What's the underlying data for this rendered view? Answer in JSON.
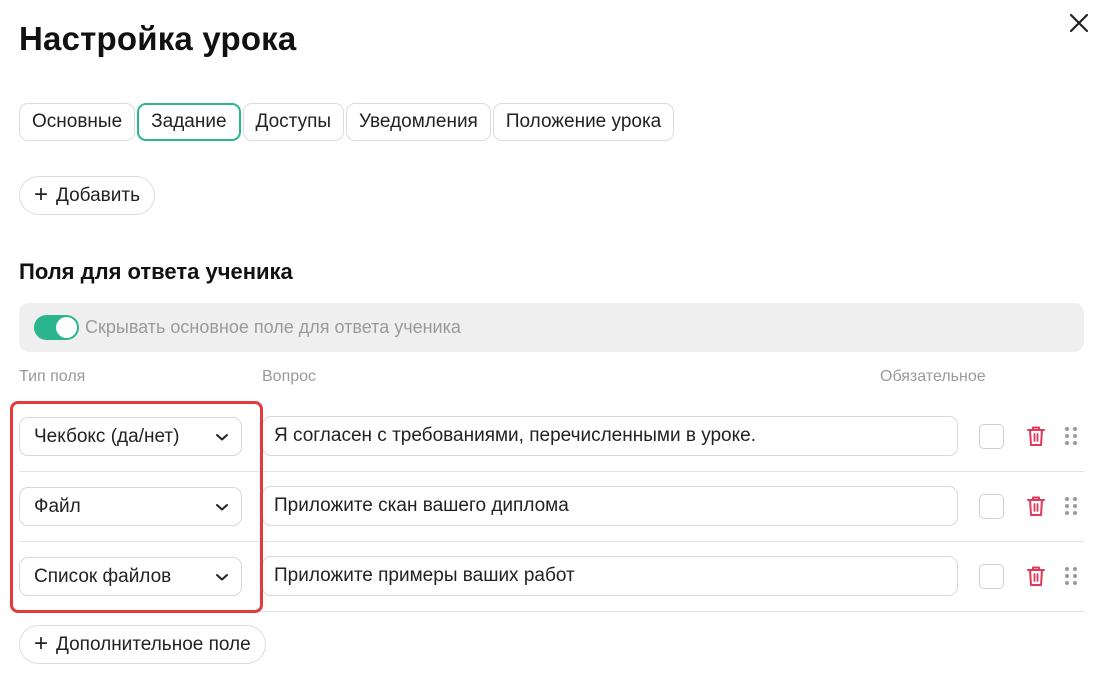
{
  "dialog": {
    "title": "Настройка урока"
  },
  "tabs": [
    {
      "label": "Основные",
      "active": false
    },
    {
      "label": "Задание",
      "active": true
    },
    {
      "label": "Доступы",
      "active": false
    },
    {
      "label": "Уведомления",
      "active": false
    },
    {
      "label": "Положение урока",
      "active": false
    }
  ],
  "buttons": {
    "add_label": "Добавить",
    "extra_field_label": "Дополнительное поле"
  },
  "section": {
    "title": "Поля для ответа ученика",
    "toggle_label": "Скрывать основное поле для ответа ученика",
    "toggle_on": true
  },
  "columns": {
    "type": "Тип поля",
    "question": "Вопрос",
    "required": "Обязательное"
  },
  "fields": [
    {
      "type": "Чекбокс (да/нет)",
      "question": "Я согласен с требованиями, перечисленными в уроке.",
      "required": false
    },
    {
      "type": "Файл",
      "question": "Приложите скан вашего диплома",
      "required": false
    },
    {
      "type": "Список файлов",
      "question": "Приложите примеры ваших работ",
      "required": false
    }
  ],
  "icons": {
    "close": "close-icon",
    "plus": "plus-icon",
    "chevron": "chevron-down-icon",
    "trash": "trash-icon",
    "drag": "drag-handle-icon"
  },
  "colors": {
    "accent": "#2bb58e",
    "delete": "#e0395a",
    "highlight": "#e23b3b"
  }
}
